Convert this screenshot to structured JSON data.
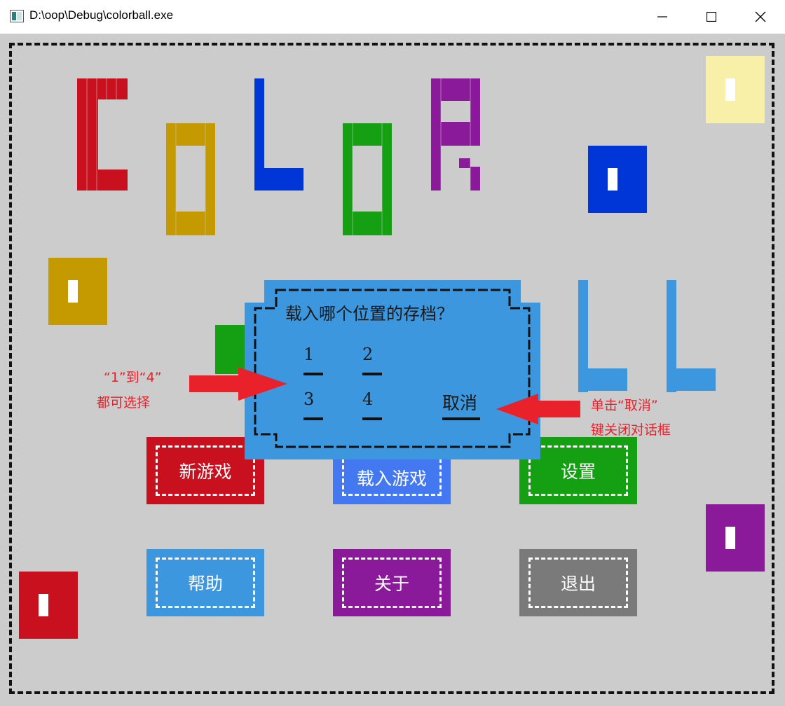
{
  "window": {
    "title": "D:\\oop\\Debug\\colorball.exe",
    "minimize_glyph": "—",
    "maximize_glyph": "☐",
    "close_glyph": "✕"
  },
  "colors": {
    "background": "#cccccc",
    "red": "#c8101f",
    "gold": "#c49a00",
    "blue": "#0036d8",
    "green": "#14a012",
    "purple": "#8b1a9a",
    "lightblue": "#3c97de",
    "paleyellow": "#f8f0a8",
    "gray": "#7a7a7a",
    "annotation": "#e8212a"
  },
  "dialog": {
    "question": "载入哪个位置的存档？",
    "slots": [
      "1",
      "2",
      "3",
      "4"
    ],
    "cancel_label": "取消"
  },
  "menu": {
    "new_game": "新游戏",
    "load_game": "载入游戏",
    "settings": "设置",
    "help": "帮助",
    "about": "关于",
    "exit": "退出"
  },
  "annotations": {
    "left_line1": "“1”到“4”",
    "left_line2": "都可选择",
    "right_line1": "单击“取消”",
    "right_line2": "键关闭对话框"
  }
}
